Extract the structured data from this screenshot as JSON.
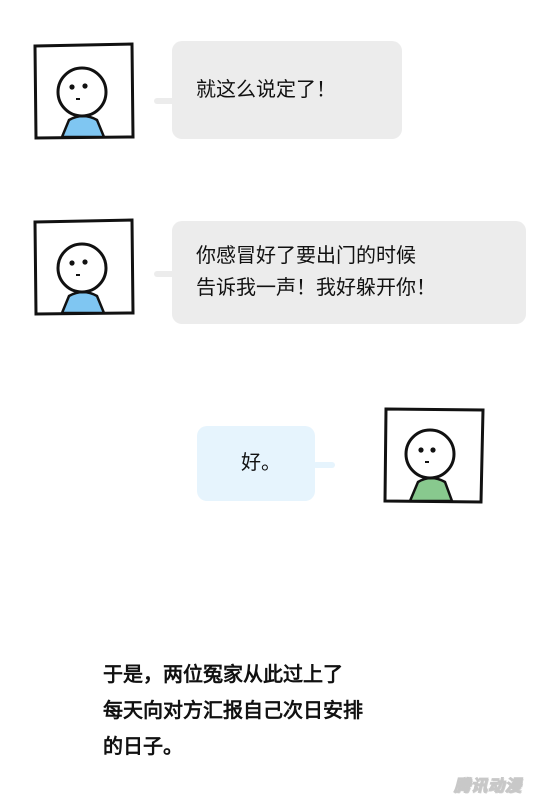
{
  "messages": [
    {
      "lines": [
        "就这么说定了！"
      ],
      "shirt_color": "#7fc6f2"
    },
    {
      "lines": [
        "你感冒好了要出门的时候",
        "告诉我一声！我好躲开你！"
      ],
      "shirt_color": "#7fc6f2"
    },
    {
      "lines": [
        "好。"
      ],
      "shirt_color": "#88c98e"
    }
  ],
  "narration": {
    "lines": [
      "于是，两位冤家从此过上了",
      "每天向对方汇报自己次日安排",
      "的日子。"
    ]
  },
  "watermark": "腾讯动漫",
  "colors": {
    "gray_bubble": "#ececec",
    "blue_bubble": "#e6f4fd",
    "frame": "#111111"
  }
}
